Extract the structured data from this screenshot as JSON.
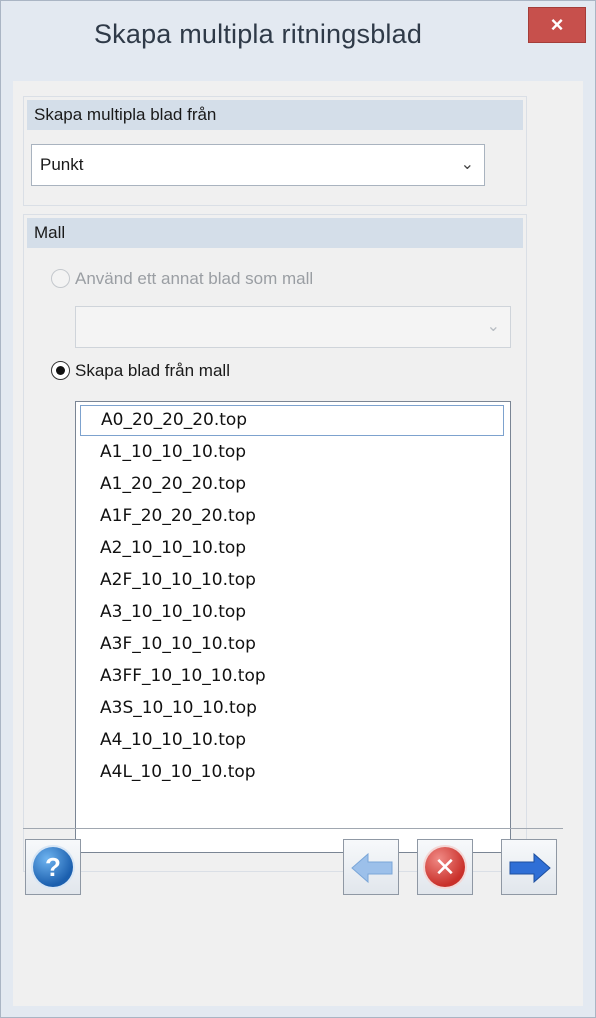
{
  "window": {
    "title": "Skapa multipla ritningsblad",
    "close_label": "×"
  },
  "source_group": {
    "header": "Skapa multipla blad från",
    "select_value": "Punkt"
  },
  "template_group": {
    "header": "Mall",
    "option_other_sheet": "Använd ett annat blad som mall",
    "other_sheet_select_value": "",
    "option_from_template": "Skapa blad från mall",
    "selected_option": "Skapa blad från mall",
    "templates": [
      "A0_20_20_20.top",
      "A1_10_10_10.top",
      "A1_20_20_20.top",
      "A1F_20_20_20.top",
      "A2_10_10_10.top",
      "A2F_10_10_10.top",
      "A3_10_10_10.top",
      "A3F_10_10_10.top",
      "A3FF_10_10_10.top",
      "A3S_10_10_10.top",
      "A4_10_10_10.top",
      "A4L_10_10_10.top"
    ],
    "selected_template": "A0_20_20_20.top"
  },
  "buttons": {
    "help": "?",
    "back": "back-arrow-icon",
    "cancel": "cancel-icon",
    "next": "forward-arrow-icon"
  },
  "colors": {
    "close_button": "#c7504c",
    "group_header": "#d4dee9",
    "help_blue": "#1b5fae",
    "next_blue": "#2f6fd6",
    "cancel_red": "#c9302a",
    "back_disabled": "#9cc0ea"
  }
}
